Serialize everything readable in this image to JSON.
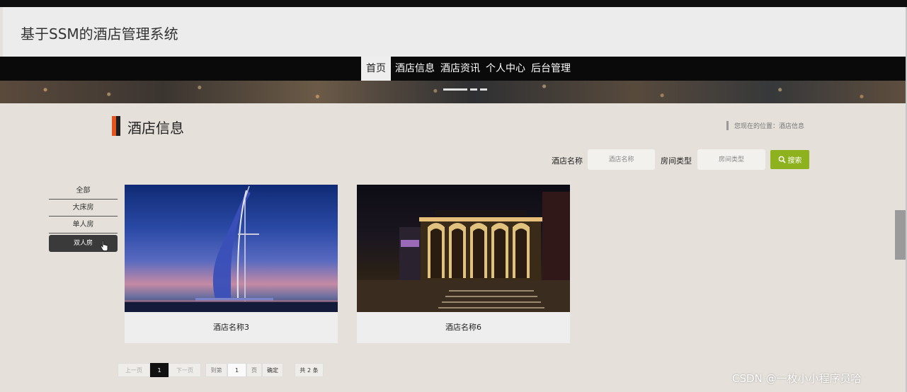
{
  "header": {
    "site_title": "基于SSM的酒店管理系统"
  },
  "nav": {
    "items": [
      {
        "label": "首页",
        "active": true
      },
      {
        "label": "酒店信息",
        "active": false
      },
      {
        "label": "酒店资讯",
        "active": false
      },
      {
        "label": "个人中心",
        "active": false
      },
      {
        "label": "后台管理",
        "active": false
      }
    ]
  },
  "section": {
    "title": "酒店信息",
    "breadcrumb": "您现在的位置：酒店信息"
  },
  "search": {
    "hotel_name_label": "酒店名称",
    "hotel_name_placeholder": "酒店名称",
    "room_type_label": "房间类型",
    "room_type_placeholder": "房间类型",
    "button_label": "搜索"
  },
  "categories": [
    {
      "label": "全部",
      "active": false
    },
    {
      "label": "大床房",
      "active": false
    },
    {
      "label": "单人房",
      "active": false
    },
    {
      "label": "双人房",
      "active": true
    }
  ],
  "cards": [
    {
      "name": "酒店名称3",
      "image": "burj-al-arab-night-photo"
    },
    {
      "name": "酒店名称6",
      "image": "restaurant-night-photo"
    }
  ],
  "pagination": {
    "prev": "上一页",
    "current": "1",
    "next": "下一页",
    "goto_label": "到第",
    "goto_value": "1",
    "page_unit": "页",
    "confirm": "确定",
    "total": "共 2 条"
  },
  "watermark": "CSDN @一枚小小程序员哈",
  "colors": {
    "accent_orange": "#e4541f",
    "search_green": "#8db21d",
    "nav_bg": "#0a0a0a"
  }
}
